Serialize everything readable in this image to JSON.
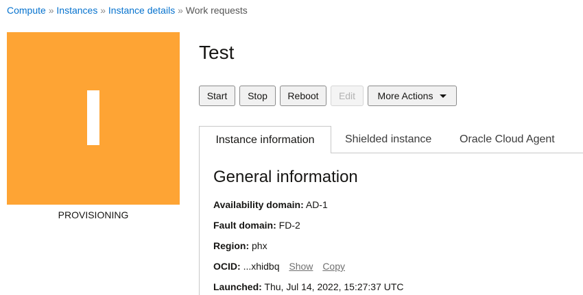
{
  "breadcrumb": {
    "items": [
      "Compute",
      "Instances",
      "Instance details"
    ],
    "current": "Work requests",
    "separator": "»"
  },
  "instance": {
    "letter": "I",
    "status": "PROVISIONING",
    "tile_color": "#fea434",
    "name": "Test"
  },
  "actions": {
    "start": "Start",
    "stop": "Stop",
    "reboot": "Reboot",
    "edit": "Edit",
    "more": "More Actions"
  },
  "tabs": [
    "Instance information",
    "Shielded instance",
    "Oracle Cloud Agent"
  ],
  "general": {
    "title": "General information",
    "availability_domain": {
      "label": "Availability domain:",
      "value": "AD-1"
    },
    "fault_domain": {
      "label": "Fault domain:",
      "value": "FD-2"
    },
    "region": {
      "label": "Region:",
      "value": "phx"
    },
    "ocid": {
      "label": "OCID:",
      "value": "...xhidbq",
      "show": "Show",
      "copy": "Copy"
    },
    "launched": {
      "label": "Launched:",
      "value": "Thu, Jul 14, 2022, 15:27:37 UTC"
    }
  }
}
